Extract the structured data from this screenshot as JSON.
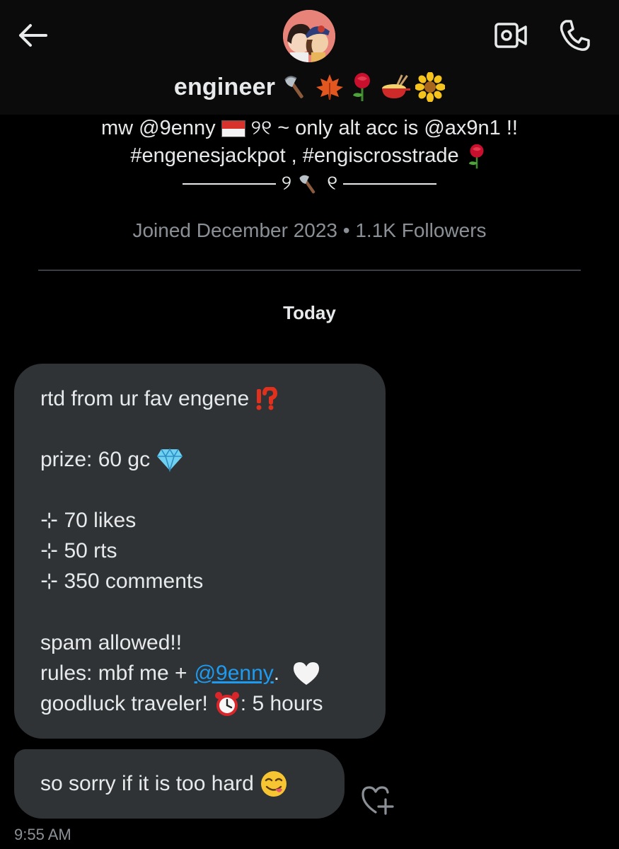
{
  "header": {
    "back_icon": "arrow-left-icon",
    "video_icon": "video-call-icon",
    "call_icon": "phone-icon",
    "name": "engineer",
    "name_emojis": [
      "axe",
      "maple-leaf",
      "rose",
      "fondue-pot",
      "sunflower"
    ]
  },
  "bio": {
    "line1_prefix": "mw @9enny",
    "line1_flag": "indonesia-flag",
    "line1_suffix": "୨୧  ~ only alt acc is @ax9n1 !!",
    "line2": "#engenesjackpot , #engiscrosstrade",
    "line2_emoji": "rose",
    "line3_left": "୨",
    "line3_right": "୧",
    "line3_emoji": "axe",
    "joined": "Joined December 2023 • 1.1K Followers"
  },
  "conversation": {
    "day_label": "Today",
    "messages": [
      {
        "line1": "rtd from ur fav engene",
        "line1_emoji": "exclamation-question-mark",
        "prize": "prize: 60 gc",
        "prize_emoji": "gem",
        "req1": "⊹ 70 likes",
        "req2": "⊹ 50 rts",
        "req3": "⊹ 350 comments",
        "spam": "spam allowed!!",
        "rules_prefix": "rules: mbf me +",
        "rules_link": "@9enny",
        "rules_suffix": ".",
        "rules_emoji": "white-heart",
        "goodluck_prefix": "goodluck traveler!",
        "goodluck_emoji": "alarm-clock",
        "goodluck_suffix": ": 5 hours"
      },
      {
        "text": "so sorry if it is too hard",
        "emoji": "face-savoring-food"
      }
    ],
    "reaction_icon": "heart-plus-icon",
    "timestamp": "9:55 AM"
  },
  "colors": {
    "background": "#000000",
    "bubble": "#2f3336",
    "text": "#e7e9ea",
    "muted": "#8b9096",
    "link": "#1d9bf0"
  }
}
